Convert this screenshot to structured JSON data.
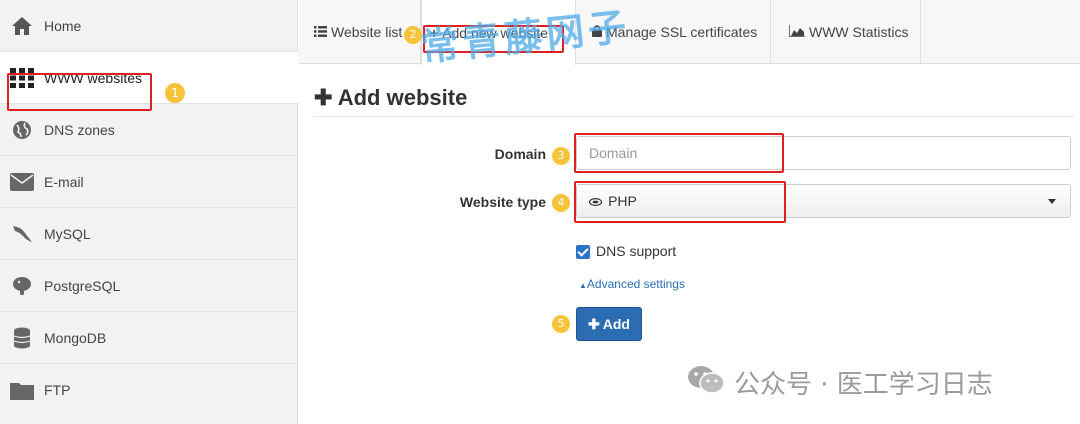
{
  "sidebar": {
    "items": [
      {
        "label": "Home",
        "icon": "home-icon"
      },
      {
        "label": "WWW websites",
        "icon": "grid-icon"
      },
      {
        "label": "DNS zones",
        "icon": "globe-icon"
      },
      {
        "label": "E-mail",
        "icon": "envelope-icon"
      },
      {
        "label": "MySQL",
        "icon": "dolphin-icon"
      },
      {
        "label": "PostgreSQL",
        "icon": "elephant-icon"
      },
      {
        "label": "MongoDB",
        "icon": "database-icon"
      },
      {
        "label": "FTP",
        "icon": "folder-icon"
      }
    ],
    "active_index": 1
  },
  "tabs": [
    {
      "label": "Website list"
    },
    {
      "label": "Add new website"
    },
    {
      "label": "Manage SSL certificates"
    },
    {
      "label": "WWW Statistics"
    }
  ],
  "markers": [
    "1",
    "2",
    "3",
    "4",
    "5"
  ],
  "page": {
    "title": "Add website"
  },
  "form": {
    "domain_label": "Domain",
    "domain_placeholder": "Domain",
    "domain_value": "",
    "website_type_label": "Website type",
    "website_type_value": "PHP",
    "dns_support_label": "DNS support",
    "dns_support_checked": true,
    "advanced_label": "Advanced settings",
    "add_button_label": "Add"
  },
  "watermark": {
    "overlay_text": "常青藤网子",
    "footer_text": "公众号 · 医工学习日志"
  },
  "colors": {
    "accent": "#2b6cb3",
    "highlight": "#e02020",
    "marker": "#f6c33a"
  }
}
